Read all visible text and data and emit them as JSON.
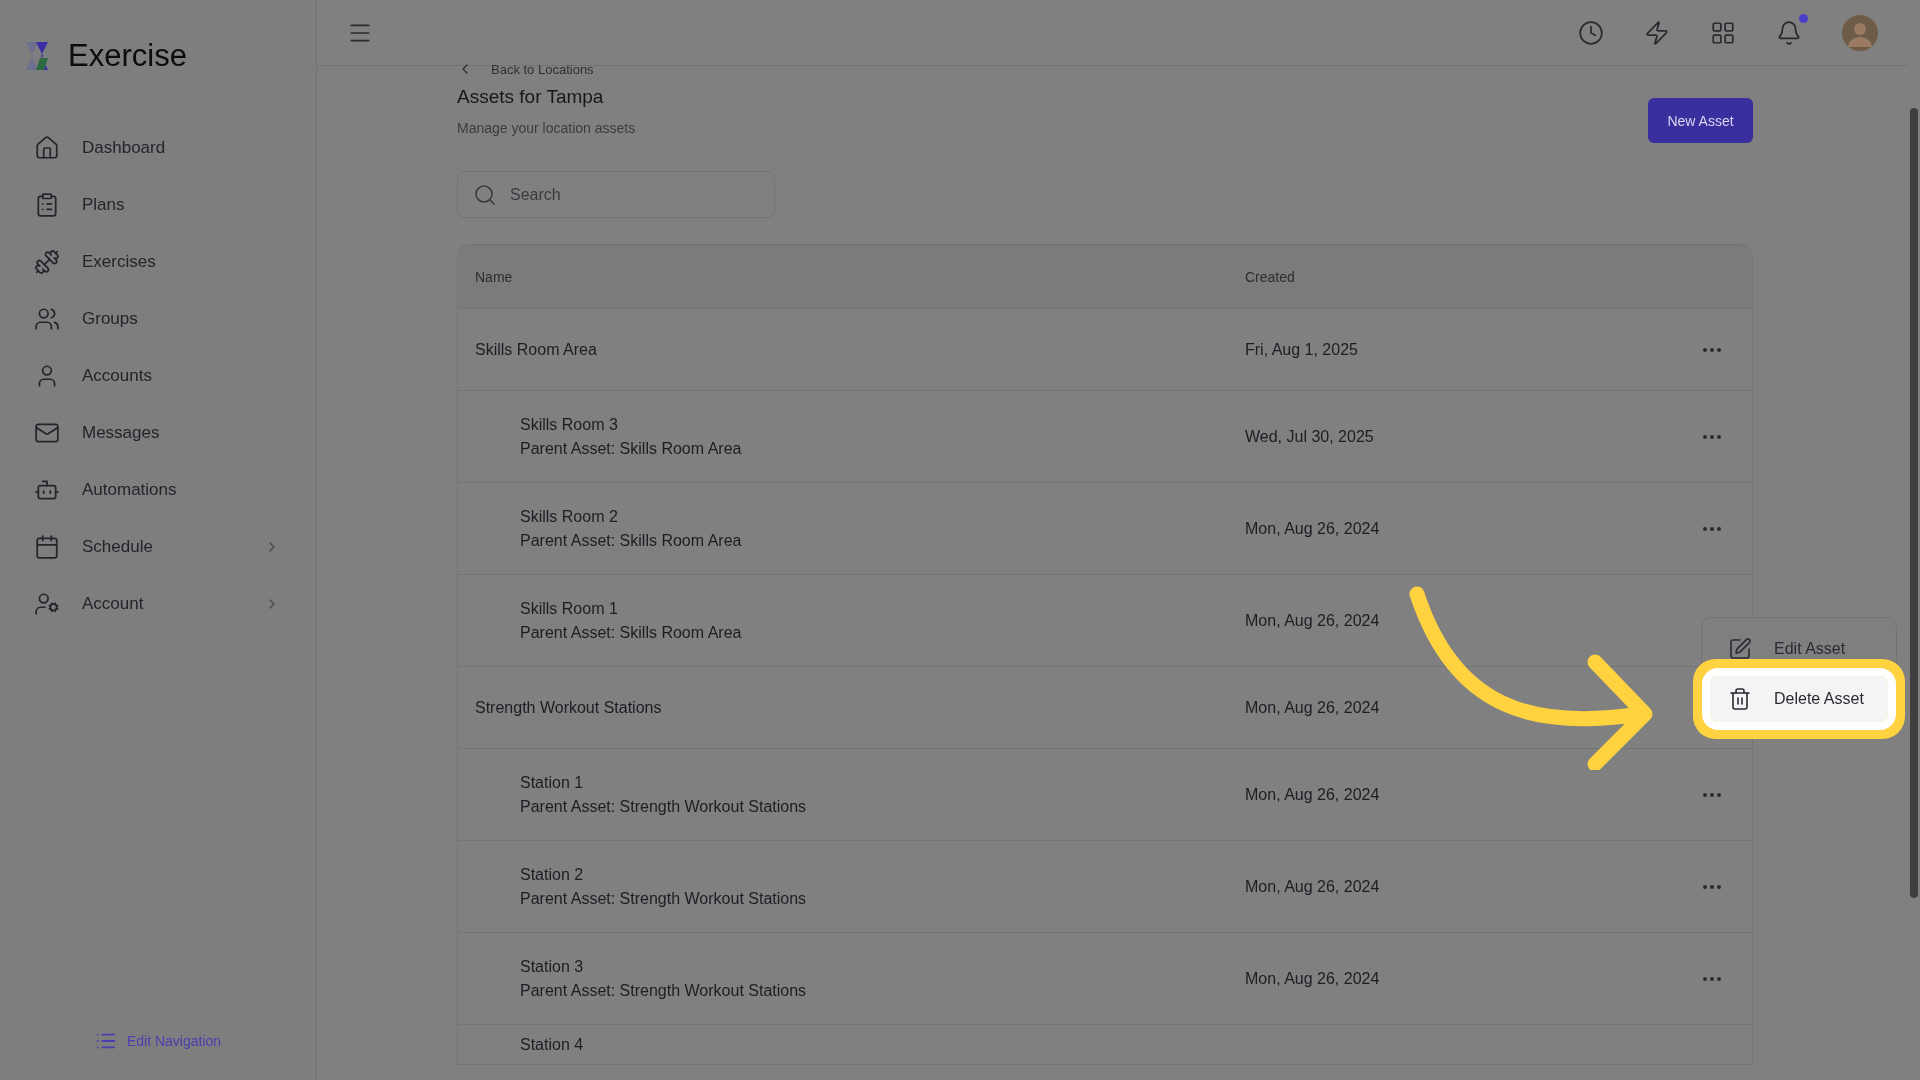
{
  "app": {
    "name": "Exercise"
  },
  "sidebar": {
    "items": [
      {
        "label": "Dashboard",
        "has_submenu": false
      },
      {
        "label": "Plans",
        "has_submenu": false
      },
      {
        "label": "Exercises",
        "has_submenu": false
      },
      {
        "label": "Groups",
        "has_submenu": false
      },
      {
        "label": "Accounts",
        "has_submenu": false
      },
      {
        "label": "Messages",
        "has_submenu": false
      },
      {
        "label": "Automations",
        "has_submenu": false
      },
      {
        "label": "Schedule",
        "has_submenu": true
      },
      {
        "label": "Account",
        "has_submenu": true
      }
    ],
    "footer_link": "Edit Navigation"
  },
  "header": {
    "notification_dot": true
  },
  "page": {
    "back_link": "Back to Locations",
    "title": "Assets for Tampa",
    "subtitle": "Manage your location assets",
    "new_button": "New Asset",
    "search": {
      "placeholder": "Search"
    }
  },
  "table": {
    "columns": [
      "Name",
      "Created"
    ],
    "rows": [
      {
        "kind": "parent",
        "name": "Skills Room Area",
        "created": "Fri, Aug 1, 2025",
        "actions": true
      },
      {
        "kind": "child",
        "name": "Skills Room 3",
        "parent": "Parent Asset: Skills Room Area",
        "created": "Wed, Jul 30, 2025",
        "actions": true
      },
      {
        "kind": "child",
        "name": "Skills Room 2",
        "parent": "Parent Asset: Skills Room Area",
        "created": "Mon, Aug 26, 2024",
        "actions": true
      },
      {
        "kind": "child",
        "name": "Skills Room 1",
        "parent": "Parent Asset: Skills Room Area",
        "created": "Mon, Aug 26, 2024"
      },
      {
        "kind": "parent",
        "name": "Strength Workout Stations",
        "created": "Mon, Aug 26, 2024"
      },
      {
        "kind": "child",
        "name": "Station 1",
        "parent": "Parent Asset: Strength Workout Stations",
        "created": "Mon, Aug 26, 2024",
        "actions": true
      },
      {
        "kind": "child",
        "name": "Station 2",
        "parent": "Parent Asset: Strength Workout Stations",
        "created": "Mon, Aug 26, 2024",
        "actions": true
      },
      {
        "kind": "child",
        "name": "Station 3",
        "parent": "Parent Asset: Strength Workout Stations",
        "created": "Mon, Aug 26, 2024",
        "actions": true
      },
      {
        "kind": "partial",
        "name": "Station 4"
      }
    ]
  },
  "context_menu": {
    "items": [
      {
        "label": "Edit Asset",
        "selected": false
      },
      {
        "label": "Delete Asset",
        "selected": true
      }
    ]
  }
}
